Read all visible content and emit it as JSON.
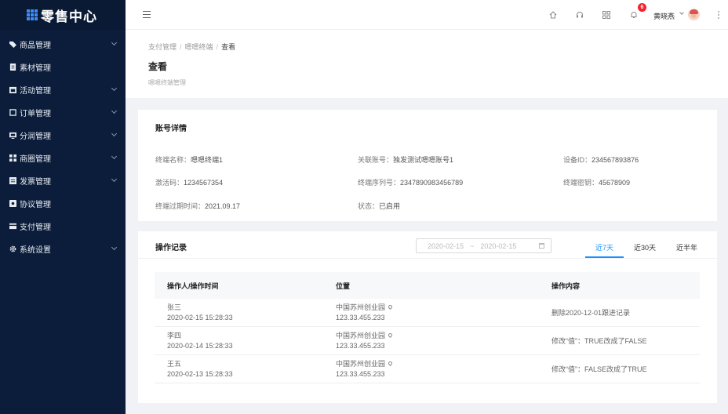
{
  "brand": {
    "title": "零售中心"
  },
  "sidebar": {
    "items": [
      {
        "label": "商品管理",
        "icon": "tag-icon",
        "has_children": true
      },
      {
        "label": "素材管理",
        "icon": "file-icon",
        "has_children": false
      },
      {
        "label": "活动管理",
        "icon": "calendar-icon",
        "has_children": true
      },
      {
        "label": "订单管理",
        "icon": "order-icon",
        "has_children": true
      },
      {
        "label": "分润管理",
        "icon": "monitor-icon",
        "has_children": true
      },
      {
        "label": "商圈管理",
        "icon": "grid-icon",
        "has_children": true
      },
      {
        "label": "发票管理",
        "icon": "invoice-icon",
        "has_children": true
      },
      {
        "label": "协议管理",
        "icon": "agreement-icon",
        "has_children": false
      },
      {
        "label": "支付管理",
        "icon": "card-icon",
        "has_children": false
      },
      {
        "label": "系统设置",
        "icon": "gear-icon",
        "has_children": true
      }
    ]
  },
  "header": {
    "notification_count": "6",
    "username": "黄晓燕"
  },
  "breadcrumb": {
    "items": [
      "支付管理",
      "嗯嗯终端",
      "查看"
    ]
  },
  "page": {
    "title": "查看",
    "subtitle": "嗯嗯终端管理"
  },
  "account": {
    "title": "账号详情",
    "fields": [
      {
        "label": "终端名称：",
        "value": "嗯嗯终端1"
      },
      {
        "label": "关联账号：",
        "value": "独发测试嗯嗯账号1"
      },
      {
        "label": "设备ID：",
        "value": "234567893876"
      },
      {
        "label": "激活码：",
        "value": "1234567354"
      },
      {
        "label": "终端序列号：",
        "value": "2347890983456789"
      },
      {
        "label": "终端密钥：",
        "value": "45678909"
      },
      {
        "label": "终端过期时间：",
        "value": "2021.09.17"
      },
      {
        "label": "状态：",
        "value": "已启用"
      }
    ]
  },
  "logs": {
    "title": "操作记录",
    "date_start": "2020-02-15",
    "date_sep": "~",
    "date_end": "2020-02-15",
    "tabs": [
      "近7天",
      "近30天",
      "近半年"
    ],
    "active_tab": 0,
    "columns": [
      "操作人/操作时间",
      "位置",
      "操作内容"
    ],
    "rows": [
      {
        "operator": "张三",
        "time": "2020-02-15 15:28:33",
        "place": "中国苏州创业园",
        "ip": "123.33.455.233",
        "content": "删除2020-12-01跟进记录"
      },
      {
        "operator": "李四",
        "time": "2020-02-14 15:28:33",
        "place": "中国苏州创业园",
        "ip": "123.33.455.233",
        "content": "修改“值”：TRUE改成了FALSE"
      },
      {
        "operator": "王五",
        "time": "2020-02-13 15:28:33",
        "place": "中国苏州创业园",
        "ip": "123.33.455.233",
        "content": "修改“值”：FALSE改成了TRUE"
      }
    ]
  },
  "colors": {
    "sidebar_bg": "#0b1d3a",
    "accent": "#1890ff",
    "badge": "#f5222d"
  }
}
